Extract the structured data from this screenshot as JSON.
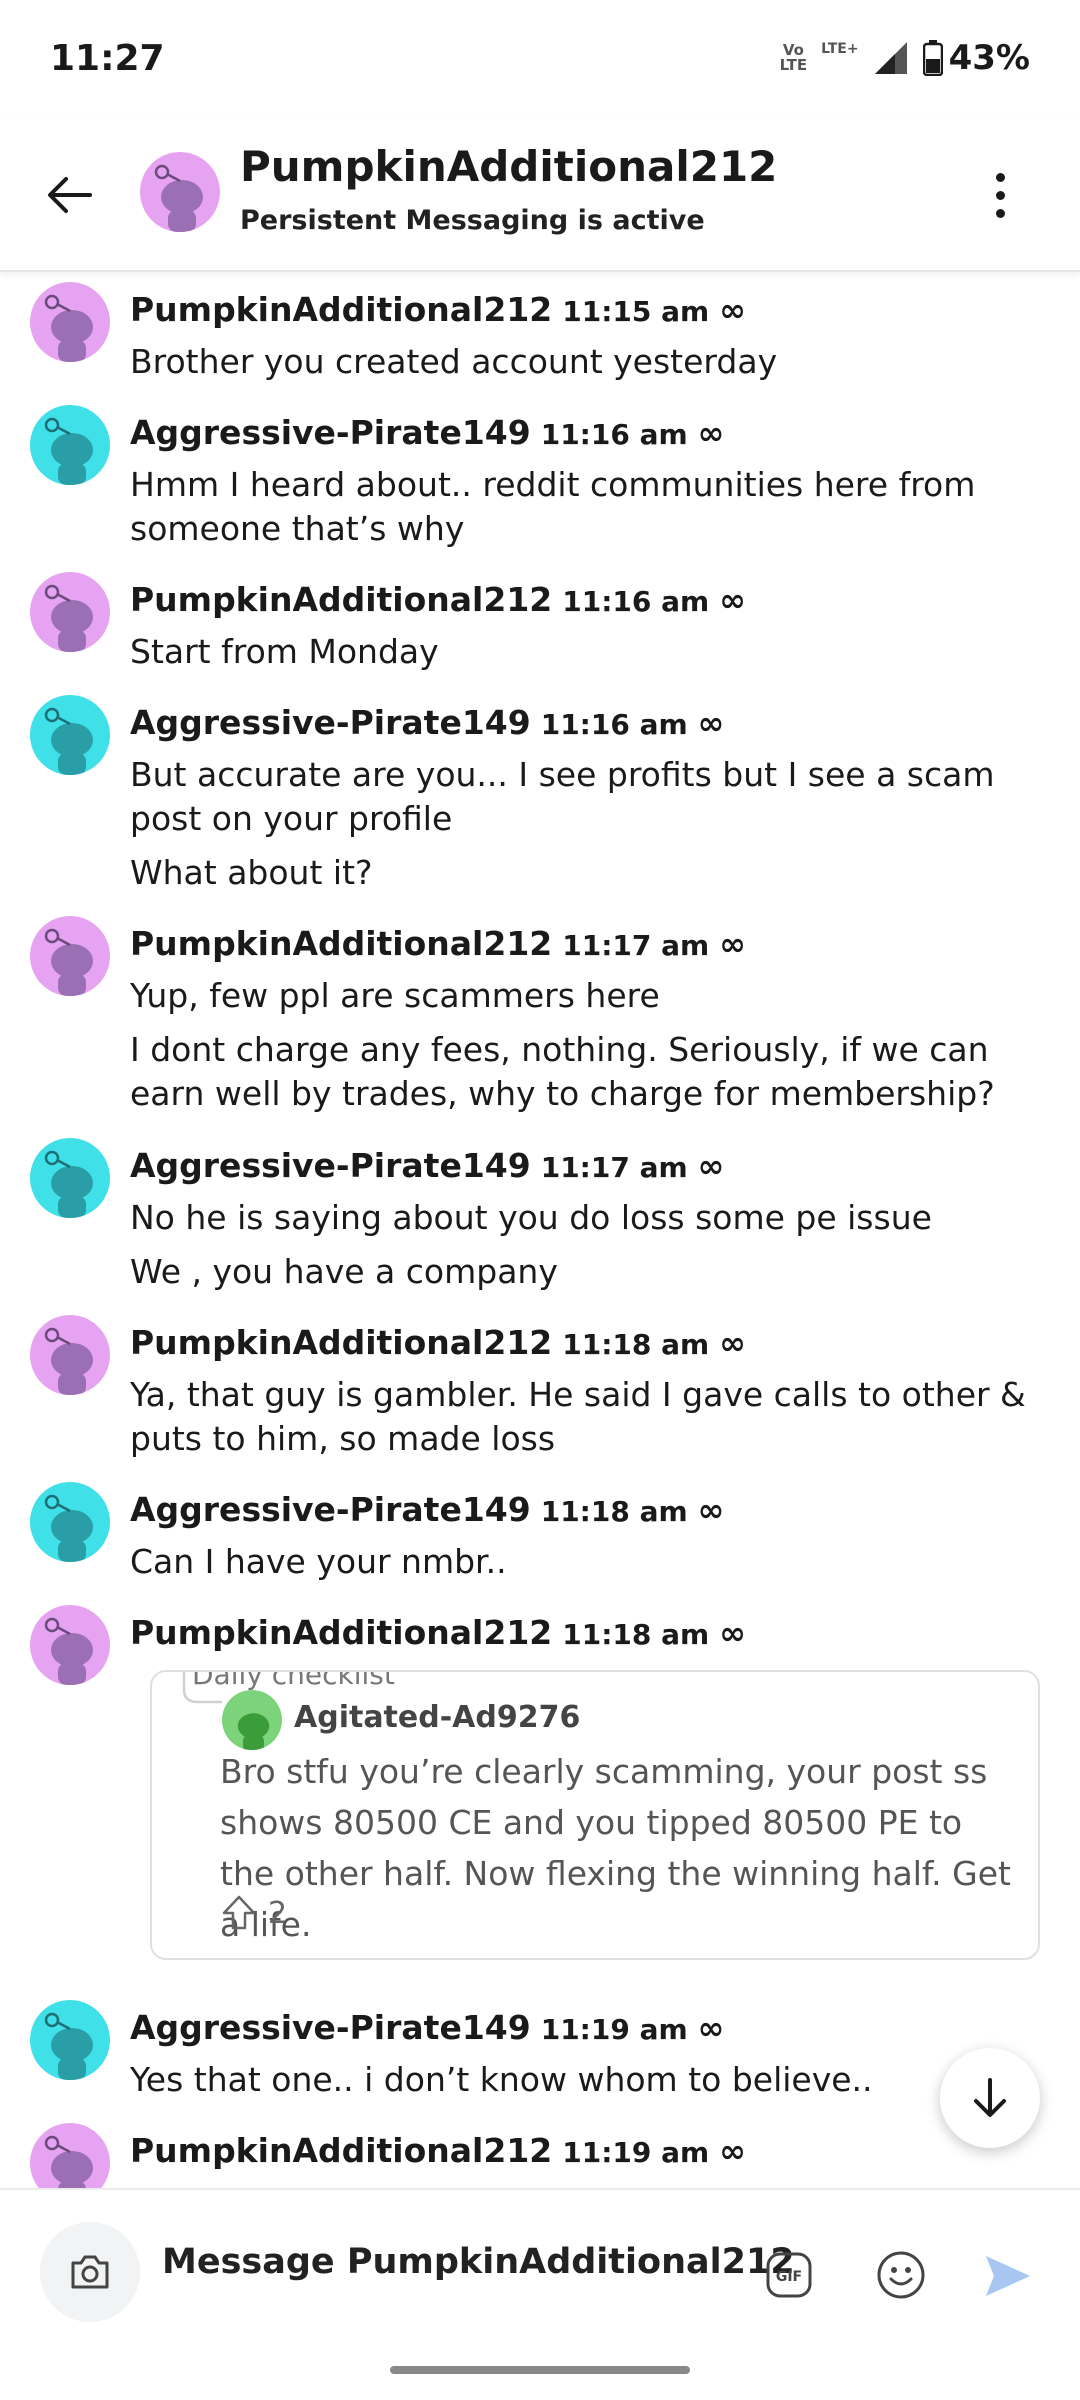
{
  "status_bar": {
    "time": "11:27",
    "volte_top": "Vo",
    "volte_bottom": "LTE",
    "lte": "LTE+",
    "battery": "43%"
  },
  "header": {
    "title": "PumpkinAdditional212",
    "subtitle": "Persistent Messaging is active"
  },
  "messages": [
    {
      "user": "PumpkinAdditional212",
      "time": "11:15 am",
      "badge": "∞",
      "lines": [
        "Brother you created account yesterday"
      ]
    },
    {
      "user": "Aggressive-Pirate149",
      "time": "11:16 am",
      "badge": "∞",
      "lines": [
        "Hmm I heard about.. reddit communities here from someone that’s why"
      ]
    },
    {
      "user": "PumpkinAdditional212",
      "time": "11:16 am",
      "badge": "∞",
      "lines": [
        "Start from Monday"
      ]
    },
    {
      "user": "Aggressive-Pirate149",
      "time": "11:16 am",
      "badge": "∞",
      "lines": [
        "But accurate are you... I see profits but I see a scam post on your profile",
        "What about it?"
      ]
    },
    {
      "user": "PumpkinAdditional212",
      "time": "11:17 am",
      "badge": "∞",
      "lines": [
        "Yup, few ppl are scammers here",
        "I dont charge any fees, nothing. Seriously, if we can earn well by trades, why to charge for membership?"
      ]
    },
    {
      "user": "Aggressive-Pirate149",
      "time": "11:17 am",
      "badge": "∞",
      "lines": [
        "No he is saying about you do loss some pe issue",
        "We , you have a company"
      ]
    },
    {
      "user": "PumpkinAdditional212",
      "time": "11:18 am",
      "badge": "∞",
      "lines": [
        "Ya, that guy is gambler. He said I gave calls to other & puts to him, so made loss"
      ]
    },
    {
      "user": "Aggressive-Pirate149",
      "time": "11:18 am",
      "badge": "∞",
      "lines": [
        "Can I have your nmbr.."
      ]
    },
    {
      "user": "PumpkinAdditional212",
      "time": "11:18 am",
      "badge": "∞",
      "lines": []
    },
    {
      "user": "Aggressive-Pirate149",
      "time": "11:19 am",
      "badge": "∞",
      "lines": [
        "Yes that one.. i don’t know whom to believe.."
      ]
    },
    {
      "user": "PumpkinAdditional212",
      "time": "11:19 am",
      "badge": "∞",
      "lines": []
    }
  ],
  "shared_comment": {
    "top_cut": "Daily checklist",
    "user": "Agitated-Ad9276",
    "text": "Bro stfu you’re clearly scamming, your post ss shows 80500 CE and you tipped 80500 PE to the other half. Now flexing the winning half. Get a life.",
    "votes": "2"
  },
  "composer": {
    "placeholder": "Message PumpkinAdditional212",
    "gif_label": "GIF"
  },
  "colors": {
    "avatar_purple": "#e6a3f2",
    "avatar_teal": "#3fe0e8",
    "send_accent": "#a7c7f2"
  },
  "icons": {
    "back": "arrow-left-icon",
    "menu": "more-vertical-icon",
    "camera": "camera-icon",
    "gif": "gif-icon",
    "emoji": "emoji-icon",
    "send": "send-icon",
    "scroll_down": "arrow-down-icon"
  }
}
